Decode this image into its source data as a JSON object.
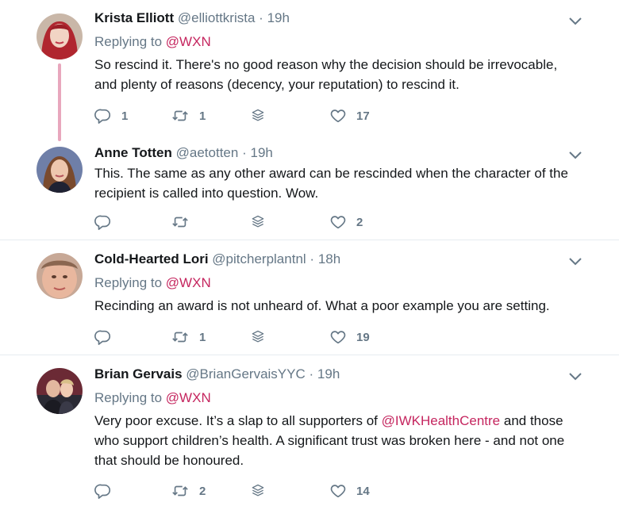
{
  "tweets": [
    {
      "name": "Krista Elliott",
      "handle": "@elliottkrista",
      "dot": "·",
      "time": "19h",
      "replying_prefix": "Replying to",
      "replying_to": "@WXN",
      "lines": [
        "So rescind it. There's no good reason why the decision should be irrevocable,",
        "and plenty of reasons (decency, your reputation) to rescind it."
      ],
      "replies": "1",
      "retweets": "1",
      "likes": "17"
    },
    {
      "name": "Anne Totten",
      "handle": "@aetotten",
      "dot": "·",
      "time": "19h",
      "lines": [
        "This. The same as any other award can be rescinded when the character of the",
        "recipient is called into question. Wow."
      ],
      "replies": "",
      "retweets": "",
      "likes": "2"
    },
    {
      "name": "Cold-Hearted Lori",
      "handle": "@pitcherplantnl",
      "dot": "·",
      "time": "18h",
      "replying_prefix": "Replying to",
      "replying_to": "@WXN",
      "lines": [
        "Recinding an award is not unheard of. What a poor example you are setting."
      ],
      "replies": "",
      "retweets": "1",
      "likes": "19"
    },
    {
      "name": "Brian Gervais",
      "handle": "@BrianGervaisYYC",
      "dot": "·",
      "time": "19h",
      "replying_prefix": "Replying to",
      "replying_to": "@WXN",
      "line1_before": "Very poor excuse. It’s a slap to all supporters of ",
      "line1_mention": "@IWKHealthCentre",
      "line1_after": " and those",
      "lines": [
        "who support children’s health.  A significant trust was broken here - and not one",
        "that should be honoured."
      ],
      "replies": "",
      "retweets": "2",
      "likes": "14"
    }
  ],
  "colors": {
    "accent": "#c5265f",
    "muted": "#657786",
    "thread": "#e8a7bd",
    "separator": "#e6ecf0"
  }
}
